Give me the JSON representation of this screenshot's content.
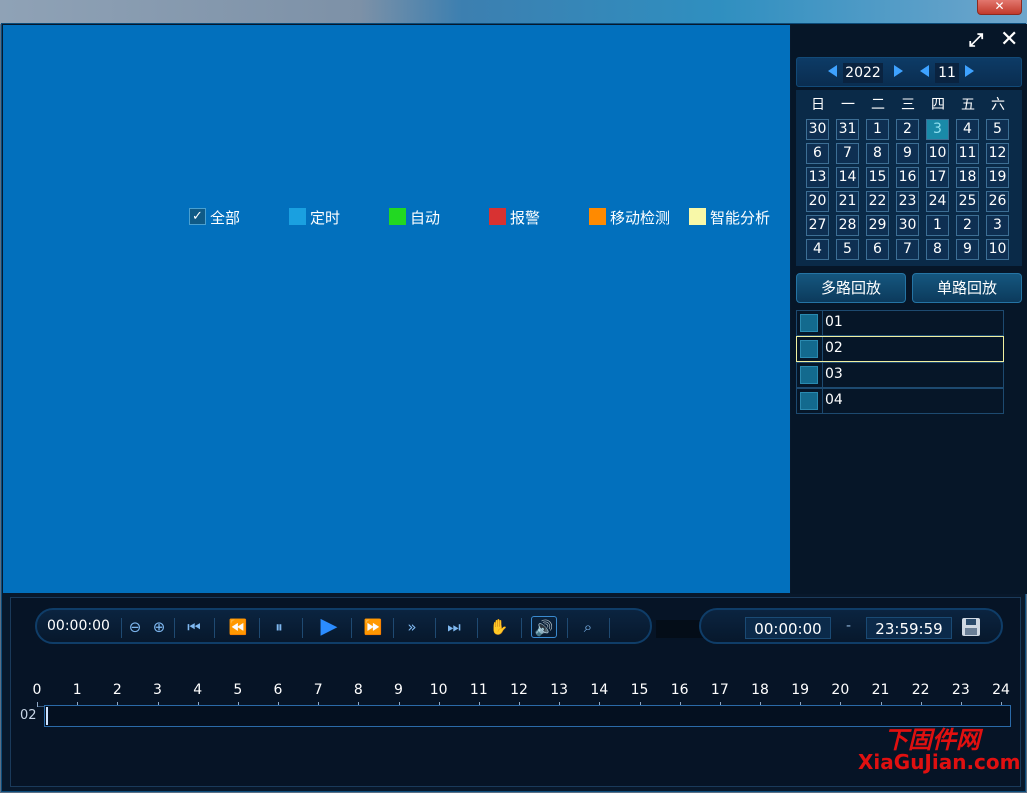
{
  "window": {
    "close_glyph": "✕"
  },
  "side": {
    "fullscreen_icon": "⤢",
    "close_icon": "✕",
    "calendar": {
      "year": "2022",
      "month": "11",
      "weekdays": [
        "日",
        "一",
        "二",
        "三",
        "四",
        "五",
        "六"
      ],
      "weeks": [
        [
          "30",
          "31",
          "1",
          "2",
          "3",
          "4",
          "5"
        ],
        [
          "6",
          "7",
          "8",
          "9",
          "10",
          "11",
          "12"
        ],
        [
          "13",
          "14",
          "15",
          "16",
          "17",
          "18",
          "19"
        ],
        [
          "20",
          "21",
          "22",
          "23",
          "24",
          "25",
          "26"
        ],
        [
          "27",
          "28",
          "29",
          "30",
          "1",
          "2",
          "3"
        ],
        [
          "4",
          "5",
          "6",
          "7",
          "8",
          "9",
          "10"
        ]
      ],
      "selected_day": "3"
    },
    "multi_playback": "多路回放",
    "single_playback": "单路回放",
    "channels": [
      "01",
      "02",
      "03",
      "04"
    ],
    "selected_channel": "02"
  },
  "controls": {
    "timecode": "00:00:00",
    "start_time": {
      "h": "00",
      "m": "00",
      "s": "00"
    },
    "end_time": {
      "h": "23",
      "m": "59",
      "s": "59"
    },
    "dash": "-"
  },
  "timeline": {
    "ticks": [
      "0",
      "1",
      "2",
      "3",
      "4",
      "5",
      "6",
      "7",
      "8",
      "9",
      "10",
      "11",
      "12",
      "13",
      "14",
      "15",
      "16",
      "17",
      "18",
      "19",
      "20",
      "21",
      "22",
      "23",
      "24"
    ],
    "track_label": "02"
  },
  "legend": [
    {
      "label": "全部",
      "color": "#0f5a86"
    },
    {
      "label": "定时",
      "color": "#1aa0e0"
    },
    {
      "label": "自动",
      "color": "#22d822"
    },
    {
      "label": "报警",
      "color": "#d83232"
    },
    {
      "label": "移动检测",
      "color": "#ff8a00"
    },
    {
      "label": "智能分析",
      "color": "#f8f8a8"
    }
  ],
  "watermark": {
    "line1": "下固件网",
    "line2": "XiaGuJian.com"
  }
}
